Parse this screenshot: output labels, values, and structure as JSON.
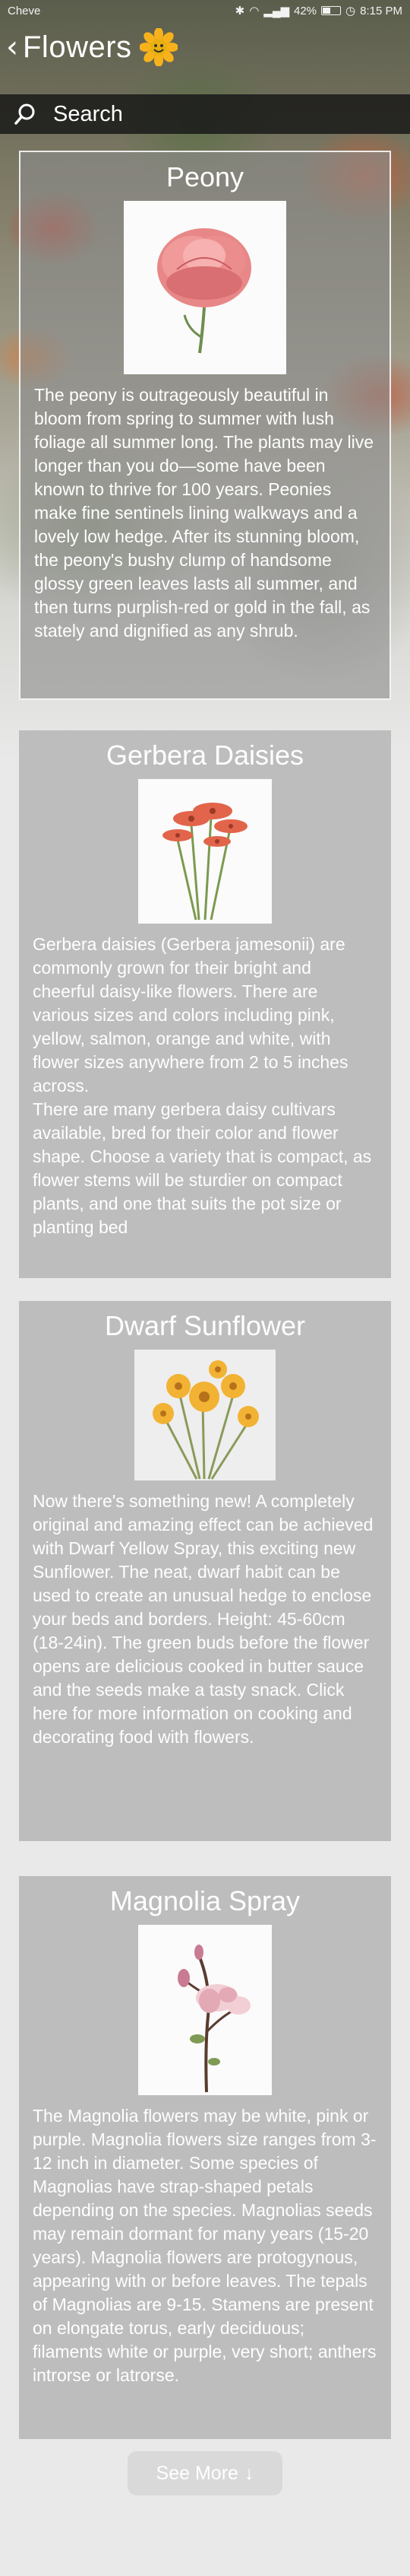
{
  "status": {
    "carrier": "Cheve",
    "battery": "42%",
    "time": "8:15 PM"
  },
  "header": {
    "title": "Flowers"
  },
  "search": {
    "label": "Search"
  },
  "cards": [
    {
      "title": "Peony",
      "text": "The peony is outrageously beautiful in bloom from spring to summer with lush foliage all summer long. The plants may live longer than you do—some have been known to thrive for 100 years. Peonies make fine sentinels lining walkways and a lovely low hedge. After its stunning bloom, the peony's bushy clump of handsome glossy green leaves lasts all summer, and then turns purplish-red or gold in the fall, as stately and dignified as any shrub."
    },
    {
      "title": "Gerbera Daisies",
      "text": "Gerbera daisies (Gerbera jamesonii) are commonly grown for their bright and cheerful daisy-like flowers. There are various sizes and colors including pink, yellow, salmon, orange and white, with flower sizes anywhere from 2 to 5 inches across.",
      "text2": "There are many gerbera daisy cultivars available, bred for their color and flower shape. Choose a variety that is compact, as flower stems will be sturdier on compact plants, and one that suits the pot size or planting bed"
    },
    {
      "title": "Dwarf Sunflower",
      "text": "Now there's something new! A completely original and amazing effect can be achieved with Dwarf Yellow Spray, this exciting new Sunflower. The neat, dwarf habit can be used to create an unusual hedge to enclose your beds and borders. Height: 45-60cm (18-24in). The green buds before the flower opens are delicious cooked in butter sauce and the seeds make a tasty snack. Click here for more information on cooking and decorating food with flowers."
    },
    {
      "title": "Magnolia Spray",
      "text": "The Magnolia flowers may be white, pink or purple. Magnolia flowers size ranges from 3-12 inch in diameter. Some species of Magnolias have strap-shaped petals depending on the species. Magnolias seeds may remain dormant for many years (15-20 years). Magnolia flowers are protogynous, appearing with or before leaves. The tepals of Magnolias are 9-15. Stamens are present on elongate torus, early deciduous; filaments white or purple, very short; anthers introrse or latrorse."
    }
  ],
  "footer": {
    "see_more": "See More"
  }
}
